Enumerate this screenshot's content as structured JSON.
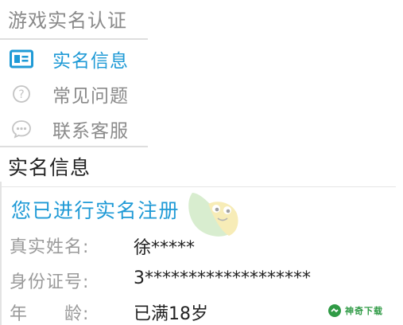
{
  "app": {
    "title": "游戏实名认证"
  },
  "menu": {
    "items": [
      {
        "label": "实名信息",
        "icon": "id-card-icon",
        "active": true
      },
      {
        "label": "常见问题",
        "icon": "question-icon",
        "active": false
      },
      {
        "label": "联系客服",
        "icon": "chat-icon",
        "active": false
      }
    ]
  },
  "section": {
    "title": "实名信息"
  },
  "verification": {
    "status": "您已进行实名注册",
    "fields": [
      {
        "label": "真实姓名:",
        "value": "徐*****"
      },
      {
        "label": "身份证号:",
        "value": "3*******************"
      },
      {
        "label": "年　　龄:",
        "value": "已满18岁"
      }
    ]
  },
  "watermark": {
    "brand": "神奇下载"
  },
  "colors": {
    "accent": "#1f9ad6",
    "muted_text": "#8a8a8a",
    "divider": "#dedede",
    "brand_green": "#2f9a45"
  }
}
